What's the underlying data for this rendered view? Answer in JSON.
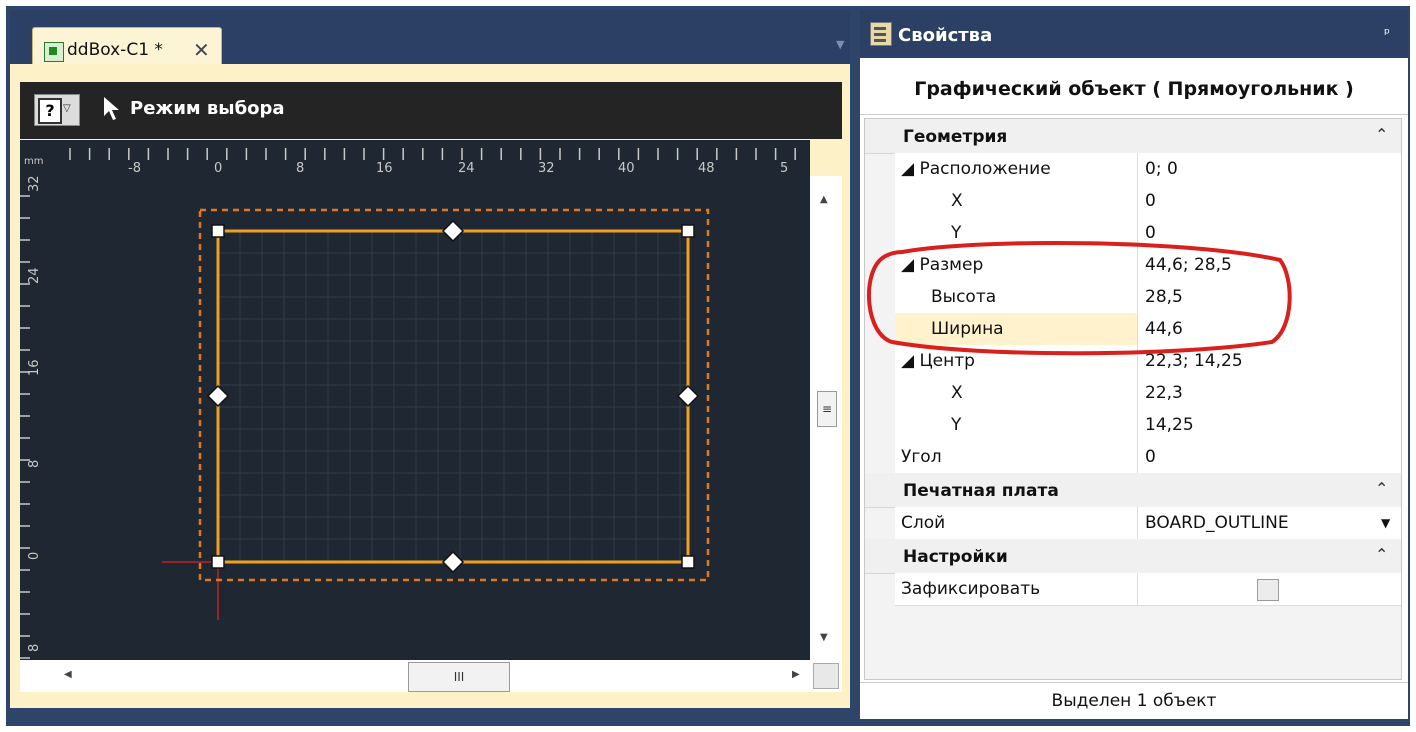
{
  "document": {
    "tab_title": "ddBox-C1 *",
    "close_glyph": "✕",
    "dropdown_glyph": "▼",
    "toolbar": {
      "help_glyph": "?",
      "help_arrow": "▽",
      "mode_label": "Режим выбора"
    },
    "ruler": {
      "unit": "mm",
      "h_ticks": [
        "-8",
        "0",
        "8",
        "16",
        "24",
        "32",
        "40",
        "48",
        "5"
      ],
      "v_ticks": [
        "32",
        "24",
        "16",
        "8",
        "0",
        "8"
      ]
    },
    "scrollbar": {
      "thumb_grip": "≡",
      "h_grip": "III",
      "up": "▲",
      "down": "▼",
      "left": "◀",
      "right": "▶"
    }
  },
  "properties": {
    "panel_title": "Свойства",
    "pin_glyph": "ᵩ",
    "object_title": "Графический объект ( Прямоугольник )",
    "categories": [
      {
        "label": "Геометрия",
        "chevron": "≈",
        "rows": [
          {
            "key": "◢ Расположение",
            "value": "0; 0"
          },
          {
            "key": "X",
            "value": "0"
          },
          {
            "key": "Y",
            "value": "0"
          },
          {
            "key": "◢ Размер",
            "value": "44,6; 28,5"
          },
          {
            "key": "Высота",
            "value": "28,5"
          },
          {
            "key": "Ширина",
            "value": "44,6"
          },
          {
            "key": "◢ Центр",
            "value": "22,3; 14,25"
          },
          {
            "key": "X",
            "value": "22,3"
          },
          {
            "key": "Y",
            "value": "14,25"
          },
          {
            "key": "Угол",
            "value": "0"
          }
        ]
      },
      {
        "label": "Печатная плата",
        "chevron": "≈",
        "rows": [
          {
            "key": "Слой",
            "value": "BOARD_OUTLINE",
            "dropdown": "▼"
          }
        ]
      },
      {
        "label": "Настройки",
        "chevron": "≈",
        "rows": [
          {
            "key": "Зафиксировать",
            "value": ""
          }
        ]
      }
    ],
    "status": "Выделен 1 объект"
  },
  "colors": {
    "chrome": "#2b4064",
    "canvas": "#1f2832",
    "outline": "#f0a020",
    "selection": "#e07820",
    "annotation": "#d9201c",
    "origin": "#c02020"
  }
}
